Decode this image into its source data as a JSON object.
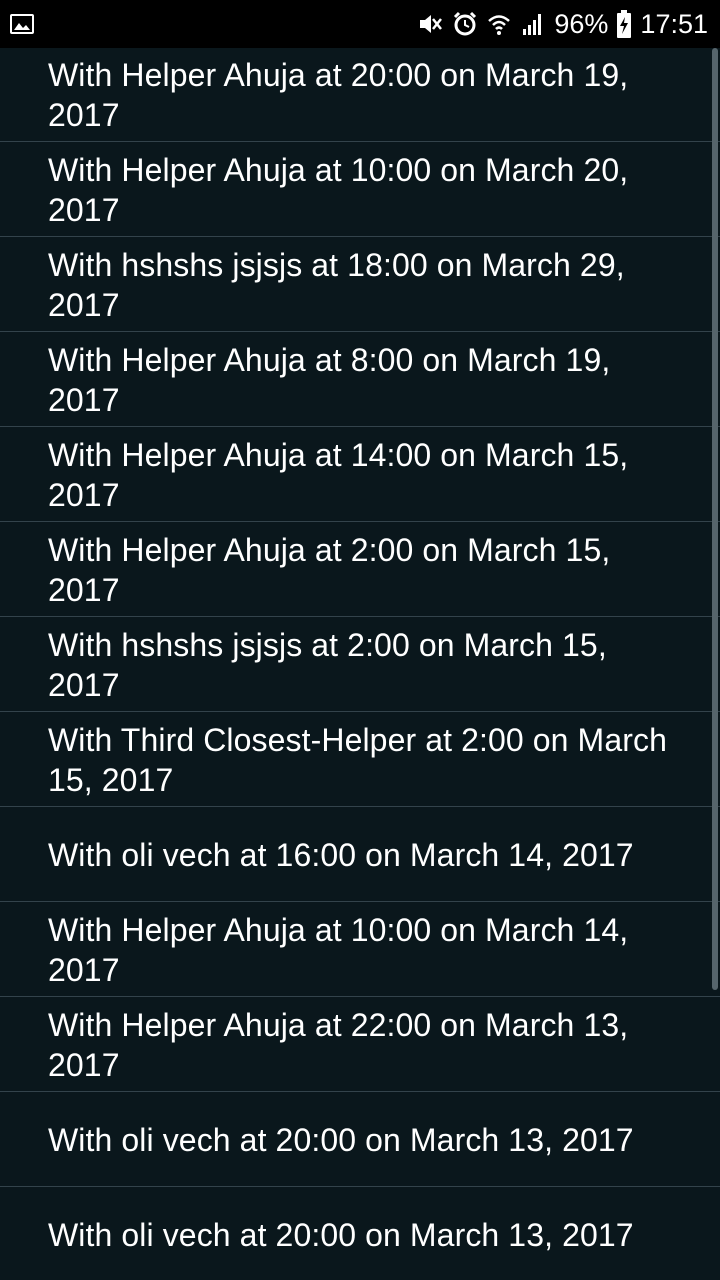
{
  "status_bar": {
    "left_icon": "image-notification-icon",
    "icons": [
      "mute-icon",
      "alarm-icon",
      "wifi-icon",
      "signal-icon"
    ],
    "battery_percent": "96%",
    "battery_icon": "battery-charging-icon",
    "time": "17:51"
  },
  "appointments": [
    {
      "text": "With Helper Ahuja at 20:00 on March 19, 2017"
    },
    {
      "text": "With Helper Ahuja at 10:00 on March 20, 2017"
    },
    {
      "text": "With hshshs jsjsjs at 18:00 on March 29, 2017"
    },
    {
      "text": "With Helper Ahuja at 8:00 on March 19, 2017"
    },
    {
      "text": "With Helper Ahuja at 14:00 on March 15, 2017"
    },
    {
      "text": "With Helper Ahuja at 2:00 on March 15, 2017"
    },
    {
      "text": "With hshshs jsjsjs at 2:00 on March 15, 2017"
    },
    {
      "text": "With Third Closest-Helper at 2:00 on March 15, 2017"
    },
    {
      "text": "With oli vech at 16:00 on March 14, 2017"
    },
    {
      "text": "With Helper Ahuja at 10:00 on March 14, 2017"
    },
    {
      "text": "With Helper Ahuja at 22:00 on March 13, 2017"
    },
    {
      "text": "With oli vech at 20:00 on March 13, 2017"
    },
    {
      "text": "With oli vech at 20:00 on March 13, 2017"
    }
  ],
  "colors": {
    "background": "#0a171c",
    "divider": "#33434b",
    "text": "#ffffff",
    "status_bar": "#000000"
  }
}
